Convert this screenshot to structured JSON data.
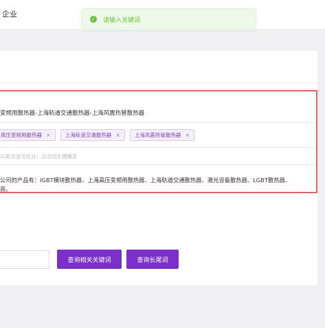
{
  "topbar": {
    "nav_label": "企业"
  },
  "toast": {
    "text": "请输入关键词",
    "color": "#67c23a"
  },
  "form": {
    "title_value": "变频用散热器-上海轨道交通散热器-上海风震热管散热器",
    "tags": [
      {
        "label": "高压变频用散热器",
        "close": "×"
      },
      {
        "label": "上海轨道交通散热器",
        "close": "×"
      },
      {
        "label": "上海风震热管散热器",
        "close": "×"
      }
    ],
    "keyword_placeholder": "以英文逗号区分，点击回车键确定",
    "description_lines": [
      "公司的产品有：IGBT模块散热器、上海高压变频用散热器、上海轨道交通散热器、激光设备散热器、LGBT散热器、",
      "商。"
    ]
  },
  "actions": {
    "related_keywords_label": "查询相关关键词",
    "long_tail_label": "查询长尾词"
  },
  "colors": {
    "accent": "#7a30c9",
    "highlight_border": "#e06464"
  }
}
